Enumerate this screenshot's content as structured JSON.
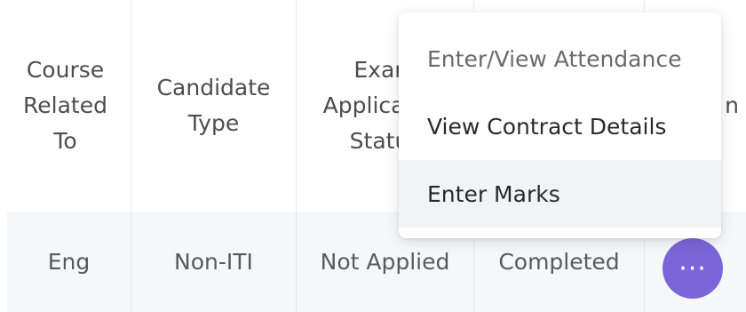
{
  "table": {
    "headers": {
      "course_related_to": "Course\nRelated\nTo",
      "candidate_type": "Candidate\nType",
      "exam_application_status": "Exam\nApplication\nStatus",
      "partial_right": "n"
    },
    "row": {
      "course_related_to": "Eng",
      "candidate_type": "Non-ITI",
      "exam_application_status": "Not Applied",
      "status": "Completed"
    },
    "actions_icon": "ellipsis-icon",
    "actions_glyph": "···"
  },
  "menu": {
    "items": [
      {
        "label": "Enter/View Attendance"
      },
      {
        "label": "View Contract Details"
      },
      {
        "label": "Enter Marks"
      }
    ],
    "hover_bg": "#f2f3f6"
  },
  "colors": {
    "accent": "#7b66d8",
    "row_bg": "#f6f7f9"
  }
}
